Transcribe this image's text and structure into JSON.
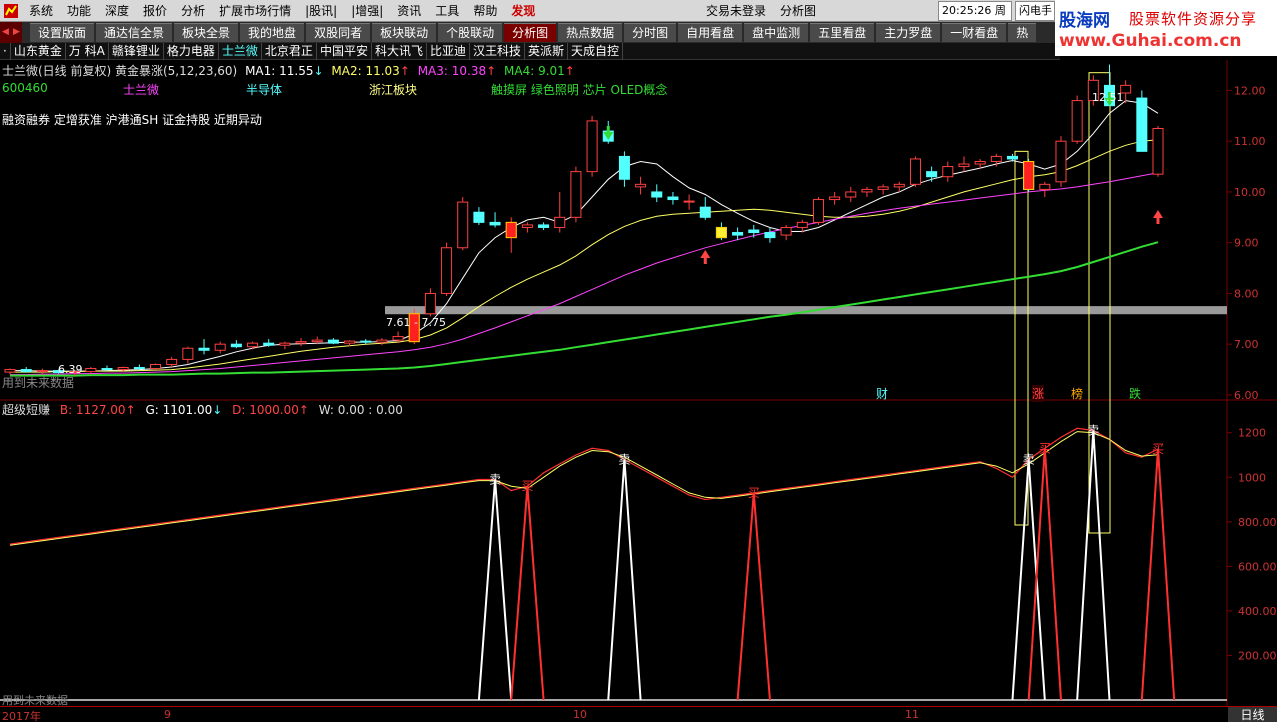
{
  "menubar": {
    "items": [
      "系统",
      "功能",
      "深度",
      "报价",
      "分析",
      "扩展市场行情",
      "|股讯|",
      "|增强|",
      "资讯",
      "工具",
      "帮助",
      "发现"
    ],
    "login_status": "交易未登录",
    "view_title": "分析图",
    "clock": "20:25:26 周一",
    "flash": "闪电手"
  },
  "banner": {
    "site": "股海网",
    "slogan": "股票软件资源分享",
    "url": "www.Guhai.com.cn"
  },
  "tabs": [
    "设置版面",
    "通达信全景",
    "板块全景",
    "我的地盘",
    "双股同者",
    "板块联动",
    "个股联动",
    "分析图",
    "热点数据",
    "分时图",
    "自用看盘",
    "盘中监测",
    "五里看盘",
    "主力罗盘",
    "一财看盘",
    "热"
  ],
  "active_tab": "分析图",
  "stocklist": [
    "·",
    "山东黄金",
    "万 科A",
    "赣锋锂业",
    "格力电器",
    "士兰微",
    "北京君正",
    "中国平安",
    "科大讯飞",
    "比亚迪",
    "汉王科技",
    "英派斯",
    "天成自控"
  ],
  "active_stock": "士兰微",
  "indicator_header": {
    "name": "士兰微(日线 前复权) 黄金暴涨(5,12,23,60)",
    "ma1": "MA1: 11.55",
    "ma2": "MA2: 11.03",
    "ma3": "MA3: 10.38",
    "ma4": "MA4: 9.01"
  },
  "stock_info": {
    "code": "600460",
    "name": "士兰微",
    "industry": "半导体",
    "region": "浙江板块",
    "concepts": "触摸屏 绿色照明 芯片 OLED概念",
    "tags": "融资融券 定增获准 沪港通SH 证金持股 近期异动"
  },
  "colors": {
    "up": "#ff4040",
    "down": "#54ffff",
    "ma1": "#ffffff",
    "ma2": "#ffff66",
    "ma3": "#ff44ff",
    "ma4": "#33dd33",
    "grid": "#7a0000"
  },
  "annotations": {
    "high_label": "12.51",
    "low_label": "6.39",
    "box_label": "7.61 - 7.75",
    "future_warning": "用到未来数据",
    "events": [
      "财",
      "涨",
      "榜",
      "跌"
    ]
  },
  "price_axis": [
    "12.00",
    "11.00",
    "10.00",
    "9.00",
    "8.00",
    "7.00",
    "6.00"
  ],
  "sub_header": {
    "name": "超级短赚",
    "b": "B: 1127.00",
    "g": "G: 1101.00",
    "d": "D: 1000.00",
    "w": "W: 0.00 : 0.00"
  },
  "sub_axis": [
    "1200",
    "1000",
    "800.00",
    "600.00",
    "400.00",
    "200.00"
  ],
  "signals": {
    "sell": "卖",
    "buy": "买"
  },
  "timeaxis": {
    "labels": [
      "2017年",
      "9",
      "10",
      "11"
    ],
    "period": "日线"
  },
  "chart_data": {
    "type": "candlestick",
    "title": "士兰微(日线 前复权)",
    "ylim": [
      5.9,
      12.6
    ],
    "candles": [
      [
        6.45,
        6.52,
        6.4,
        6.5
      ],
      [
        6.5,
        6.55,
        6.44,
        6.46
      ],
      [
        6.46,
        6.52,
        6.4,
        6.48
      ],
      [
        6.48,
        6.5,
        6.42,
        6.44
      ],
      [
        6.44,
        6.48,
        6.38,
        6.46
      ],
      [
        6.46,
        6.55,
        6.42,
        6.52
      ],
      [
        6.52,
        6.58,
        6.48,
        6.5
      ],
      [
        6.5,
        6.56,
        6.45,
        6.54
      ],
      [
        6.54,
        6.6,
        6.48,
        6.52
      ],
      [
        6.52,
        6.62,
        6.5,
        6.6
      ],
      [
        6.6,
        6.75,
        6.55,
        6.7
      ],
      [
        6.7,
        6.95,
        6.62,
        6.92
      ],
      [
        6.92,
        7.1,
        6.8,
        6.88
      ],
      [
        6.88,
        7.05,
        6.82,
        7.0
      ],
      [
        7.0,
        7.08,
        6.92,
        6.95
      ],
      [
        6.95,
        7.05,
        6.9,
        7.02
      ],
      [
        7.02,
        7.1,
        6.95,
        6.98
      ],
      [
        6.98,
        7.05,
        6.9,
        7.02
      ],
      [
        7.02,
        7.12,
        6.96,
        7.05
      ],
      [
        7.05,
        7.15,
        7.0,
        7.08
      ],
      [
        7.08,
        7.12,
        7.0,
        7.02
      ],
      [
        7.02,
        7.08,
        6.96,
        7.06
      ],
      [
        7.06,
        7.1,
        7.0,
        7.04
      ],
      [
        7.04,
        7.12,
        6.98,
        7.08
      ],
      [
        7.08,
        7.25,
        7.02,
        7.15
      ],
      [
        7.05,
        7.7,
        7.0,
        7.6
      ],
      [
        7.6,
        8.1,
        7.55,
        8.0
      ],
      [
        8.0,
        9.0,
        7.95,
        8.9
      ],
      [
        8.9,
        9.9,
        8.85,
        9.8
      ],
      [
        9.6,
        9.7,
        9.35,
        9.4
      ],
      [
        9.4,
        9.6,
        9.3,
        9.35
      ],
      [
        9.1,
        9.5,
        8.8,
        9.4
      ],
      [
        9.3,
        9.4,
        9.2,
        9.35
      ],
      [
        9.35,
        9.4,
        9.25,
        9.3
      ],
      [
        9.3,
        10.0,
        9.2,
        9.5
      ],
      [
        9.5,
        10.5,
        9.4,
        10.4
      ],
      [
        10.4,
        11.5,
        10.3,
        11.4
      ],
      [
        11.2,
        11.4,
        10.95,
        11.0
      ],
      [
        10.7,
        10.8,
        10.1,
        10.25
      ],
      [
        10.1,
        10.3,
        9.95,
        10.15
      ],
      [
        10.0,
        10.15,
        9.8,
        9.9
      ],
      [
        9.9,
        10.0,
        9.75,
        9.85
      ],
      [
        9.8,
        9.95,
        9.65,
        9.82
      ],
      [
        9.7,
        9.9,
        9.45,
        9.5
      ],
      [
        9.3,
        9.4,
        9.05,
        9.1
      ],
      [
        9.2,
        9.3,
        9.05,
        9.15
      ],
      [
        9.25,
        9.35,
        9.1,
        9.2
      ],
      [
        9.2,
        9.3,
        9.0,
        9.1
      ],
      [
        9.15,
        9.35,
        9.05,
        9.3
      ],
      [
        9.3,
        9.45,
        9.2,
        9.4
      ],
      [
        9.4,
        9.9,
        9.35,
        9.85
      ],
      [
        9.85,
        10.0,
        9.75,
        9.9
      ],
      [
        9.9,
        10.1,
        9.8,
        10.0
      ],
      [
        10.0,
        10.1,
        9.9,
        10.05
      ],
      [
        10.05,
        10.15,
        9.95,
        10.1
      ],
      [
        10.1,
        10.2,
        10.0,
        10.15
      ],
      [
        10.15,
        10.7,
        10.1,
        10.65
      ],
      [
        10.4,
        10.5,
        10.2,
        10.3
      ],
      [
        10.3,
        10.6,
        10.2,
        10.5
      ],
      [
        10.5,
        10.7,
        10.4,
        10.55
      ],
      [
        10.55,
        10.65,
        10.45,
        10.6
      ],
      [
        10.6,
        10.75,
        10.5,
        10.7
      ],
      [
        10.7,
        10.75,
        10.6,
        10.65
      ],
      [
        10.6,
        10.65,
        10.0,
        10.05
      ],
      [
        10.05,
        10.2,
        9.9,
        10.15
      ],
      [
        10.2,
        11.1,
        10.1,
        11.0
      ],
      [
        11.0,
        11.9,
        10.95,
        11.8
      ],
      [
        11.8,
        12.3,
        11.7,
        12.2
      ],
      [
        12.1,
        12.51,
        11.7,
        11.7
      ],
      [
        11.95,
        12.2,
        11.75,
        12.1
      ],
      [
        11.85,
        12.0,
        10.8,
        10.8
      ],
      [
        10.35,
        11.3,
        10.3,
        11.25
      ]
    ],
    "ma": {
      "ma1": [
        6.48,
        6.48,
        6.47,
        6.47,
        6.47,
        6.47,
        6.48,
        6.49,
        6.5,
        6.52,
        6.55,
        6.6,
        6.68,
        6.76,
        6.85,
        6.92,
        6.98,
        7.0,
        7.01,
        7.02,
        7.03,
        7.04,
        7.04,
        7.05,
        7.07,
        7.2,
        7.42,
        7.8,
        8.3,
        8.8,
        9.1,
        9.3,
        9.45,
        9.5,
        9.4,
        9.55,
        9.9,
        10.25,
        10.5,
        10.6,
        10.55,
        10.3,
        10.08,
        9.95,
        9.75,
        9.58,
        9.42,
        9.3,
        9.22,
        9.22,
        9.3,
        9.45,
        9.6,
        9.75,
        9.9,
        10.0,
        10.15,
        10.25,
        10.33,
        10.4,
        10.47,
        10.55,
        10.62,
        10.55,
        10.45,
        10.55,
        10.8,
        11.15,
        11.55,
        11.8,
        11.75,
        11.55
      ],
      "ma2": [
        6.45,
        6.45,
        6.45,
        6.46,
        6.46,
        6.47,
        6.47,
        6.47,
        6.48,
        6.49,
        6.5,
        6.53,
        6.57,
        6.61,
        6.66,
        6.71,
        6.76,
        6.81,
        6.86,
        6.9,
        6.94,
        6.97,
        7.0,
        7.02,
        7.04,
        7.09,
        7.18,
        7.32,
        7.52,
        7.74,
        7.94,
        8.12,
        8.28,
        8.42,
        8.56,
        8.74,
        8.96,
        9.16,
        9.32,
        9.44,
        9.52,
        9.56,
        9.58,
        9.6,
        9.62,
        9.64,
        9.66,
        9.64,
        9.6,
        9.56,
        9.52,
        9.5,
        9.5,
        9.52,
        9.56,
        9.62,
        9.7,
        9.8,
        9.9,
        10.0,
        10.08,
        10.16,
        10.24,
        10.3,
        10.34,
        10.4,
        10.52,
        10.66,
        10.8,
        10.92,
        11.0,
        11.03
      ],
      "ma3": [
        6.4,
        6.4,
        6.41,
        6.41,
        6.42,
        6.42,
        6.43,
        6.43,
        6.44,
        6.45,
        6.46,
        6.48,
        6.5,
        6.52,
        6.55,
        6.58,
        6.61,
        6.64,
        6.67,
        6.7,
        6.73,
        6.76,
        6.79,
        6.82,
        6.85,
        6.89,
        6.94,
        7.01,
        7.1,
        7.21,
        7.32,
        7.44,
        7.56,
        7.68,
        7.8,
        7.94,
        8.08,
        8.22,
        8.36,
        8.48,
        8.6,
        8.7,
        8.8,
        8.9,
        8.98,
        9.06,
        9.14,
        9.21,
        9.28,
        9.34,
        9.4,
        9.46,
        9.52,
        9.58,
        9.63,
        9.68,
        9.72,
        9.76,
        9.8,
        9.84,
        9.88,
        9.92,
        9.96,
        10.0,
        10.03,
        10.06,
        10.1,
        10.15,
        10.2,
        10.26,
        10.32,
        10.38
      ],
      "ma4": [
        6.38,
        6.38,
        6.38,
        6.38,
        6.38,
        6.39,
        6.39,
        6.39,
        6.4,
        6.4,
        6.4,
        6.41,
        6.42,
        6.42,
        6.43,
        6.44,
        6.44,
        6.45,
        6.46,
        6.47,
        6.48,
        6.49,
        6.5,
        6.51,
        6.52,
        6.54,
        6.57,
        6.61,
        6.65,
        6.69,
        6.73,
        6.77,
        6.81,
        6.85,
        6.89,
        6.94,
        6.99,
        7.04,
        7.09,
        7.14,
        7.19,
        7.24,
        7.29,
        7.34,
        7.39,
        7.44,
        7.49,
        7.54,
        7.58,
        7.63,
        7.68,
        7.73,
        7.78,
        7.83,
        7.88,
        7.93,
        7.98,
        8.03,
        8.08,
        8.13,
        8.18,
        8.23,
        8.28,
        8.33,
        8.38,
        8.44,
        8.52,
        8.62,
        8.72,
        8.82,
        8.92,
        9.01
      ]
    },
    "sub_series": {
      "b": [
        700,
        710,
        720,
        730,
        740,
        750,
        760,
        770,
        780,
        790,
        800,
        810,
        820,
        830,
        840,
        850,
        860,
        870,
        880,
        890,
        900,
        910,
        920,
        930,
        940,
        950,
        960,
        970,
        980,
        990,
        990,
        940,
        960,
        1020,
        1060,
        1100,
        1130,
        1120,
        1080,
        1040,
        1000,
        960,
        920,
        900,
        910,
        920,
        930,
        940,
        950,
        960,
        970,
        980,
        990,
        1000,
        1010,
        1020,
        1030,
        1040,
        1050,
        1060,
        1070,
        1040,
        1000,
        1080,
        1130,
        1180,
        1220,
        1210,
        1170,
        1110,
        1090,
        1127
      ],
      "g": [
        695,
        705,
        715,
        725,
        735,
        745,
        755,
        765,
        775,
        785,
        795,
        805,
        815,
        825,
        835,
        845,
        855,
        865,
        875,
        885,
        895,
        905,
        915,
        925,
        935,
        945,
        955,
        965,
        975,
        985,
        985,
        960,
        950,
        1000,
        1050,
        1090,
        1120,
        1115,
        1090,
        1050,
        1010,
        970,
        930,
        910,
        905,
        915,
        925,
        935,
        945,
        955,
        965,
        975,
        985,
        995,
        1005,
        1015,
        1025,
        1035,
        1045,
        1055,
        1065,
        1050,
        1020,
        1060,
        1110,
        1160,
        1205,
        1200,
        1170,
        1120,
        1095,
        1101
      ],
      "sell_at": [
        30,
        38,
        63,
        67
      ],
      "buy_at": [
        32,
        46,
        64,
        71
      ],
      "ylim": [
        0,
        1320
      ]
    }
  }
}
